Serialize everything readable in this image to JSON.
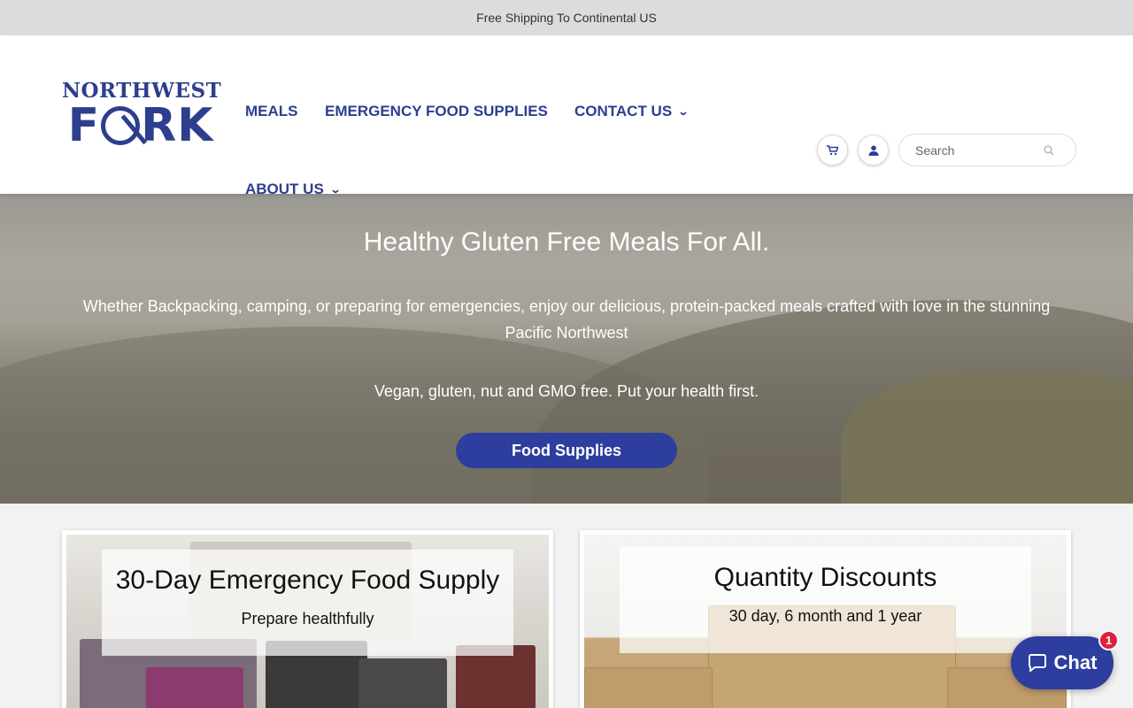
{
  "announcement": "Free Shipping To Continental US",
  "logo": {
    "line1": "NORTHWEST",
    "line2_a": "F",
    "line2_b": "RK"
  },
  "nav": {
    "items": [
      {
        "label": "MEALS"
      },
      {
        "label": "EMERGENCY FOOD SUPPLIES"
      },
      {
        "label": "CONTACT US"
      },
      {
        "label": "ABOUT US"
      }
    ]
  },
  "header_icons": [
    "cart-icon",
    "user-icon"
  ],
  "search": {
    "placeholder": "Search",
    "icon": "search-icon"
  },
  "hero": {
    "title": "Healthy Gluten Free Meals For All.",
    "subtitle": "Whether Backpacking, camping, or preparing for emergencies, enjoy our delicious, protein-packed meals crafted with love in the stunning Pacific Northwest",
    "tagline": "Vegan, gluten, nut and GMO free. Put your health first.",
    "button_label": "Food Supplies"
  },
  "cards": [
    {
      "title": "30-Day Emergency Food Supply",
      "subtitle": "Prepare healthfully"
    },
    {
      "title": "Quantity Discounts",
      "subtitle": "30 day, 6 month and 1 year"
    }
  ],
  "chat": {
    "label": "Chat",
    "badge": "1"
  },
  "colors": {
    "brand": "#2d3e8f",
    "button": "#2d3e9f",
    "badge": "#d9233c"
  }
}
